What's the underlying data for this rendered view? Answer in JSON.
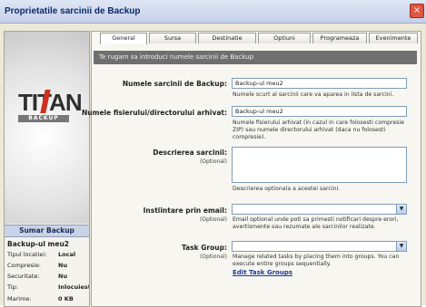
{
  "window": {
    "title": "Proprietatile sarcinii de Backup",
    "close_glyph": "×"
  },
  "tabs": [
    "General",
    "Sursa",
    "Destinatie",
    "Optiuni",
    "Programeaza",
    "Evenimente"
  ],
  "banner": "Te rugam sa introduci numele sarcinii de Backup",
  "logo": {
    "text": "TITAN",
    "sub": "BACKUP"
  },
  "summary": {
    "header": "Sumar Backup",
    "name": "Backup-ul meu2",
    "rows": [
      {
        "k": "Tipul locatiei:",
        "v": "Local"
      },
      {
        "k": "Compresie:",
        "v": "Nu"
      },
      {
        "k": "Securitate:",
        "v": "Nu"
      },
      {
        "k": "Tip:",
        "v": "Inlocuieste"
      },
      {
        "k": "Marime:",
        "v": "0 KB"
      }
    ]
  },
  "form": {
    "task_name": {
      "label": "Numele sarcinii de Backup:",
      "value": "Backup-ul meu2",
      "help": "Numele scurt al sarcinii care va aparea in lista de sarcini."
    },
    "archive_name": {
      "label": "Numele fisierului/directorului arhivat:",
      "value": "Backup-ul meu2",
      "help1": "Numele fisierului arhivat (in cazul in care folosesti compresie",
      "help2": "ZIP) sau numele directorului arhivat (daca nu folosesti",
      "help3": "compresie)."
    },
    "description": {
      "label": "Descrierea sarcinii:",
      "optional": "(Optional)",
      "help": "Descrierea optionala a acestei sarcini."
    },
    "email": {
      "label": "Instiintare prin email:",
      "optional": "(Optional)",
      "help1": "Email optional unde poti sa primesti notificari despre erori,",
      "help2": "avertismente sau rezumate ale sarcinilor realizate."
    },
    "group": {
      "label": "Task Group:",
      "optional": "(Optional)",
      "help1": "Manage related tasks by placing them into groups. You can",
      "help2": "execute entire groups sequentially.",
      "link": "Edit Task Groups"
    }
  }
}
